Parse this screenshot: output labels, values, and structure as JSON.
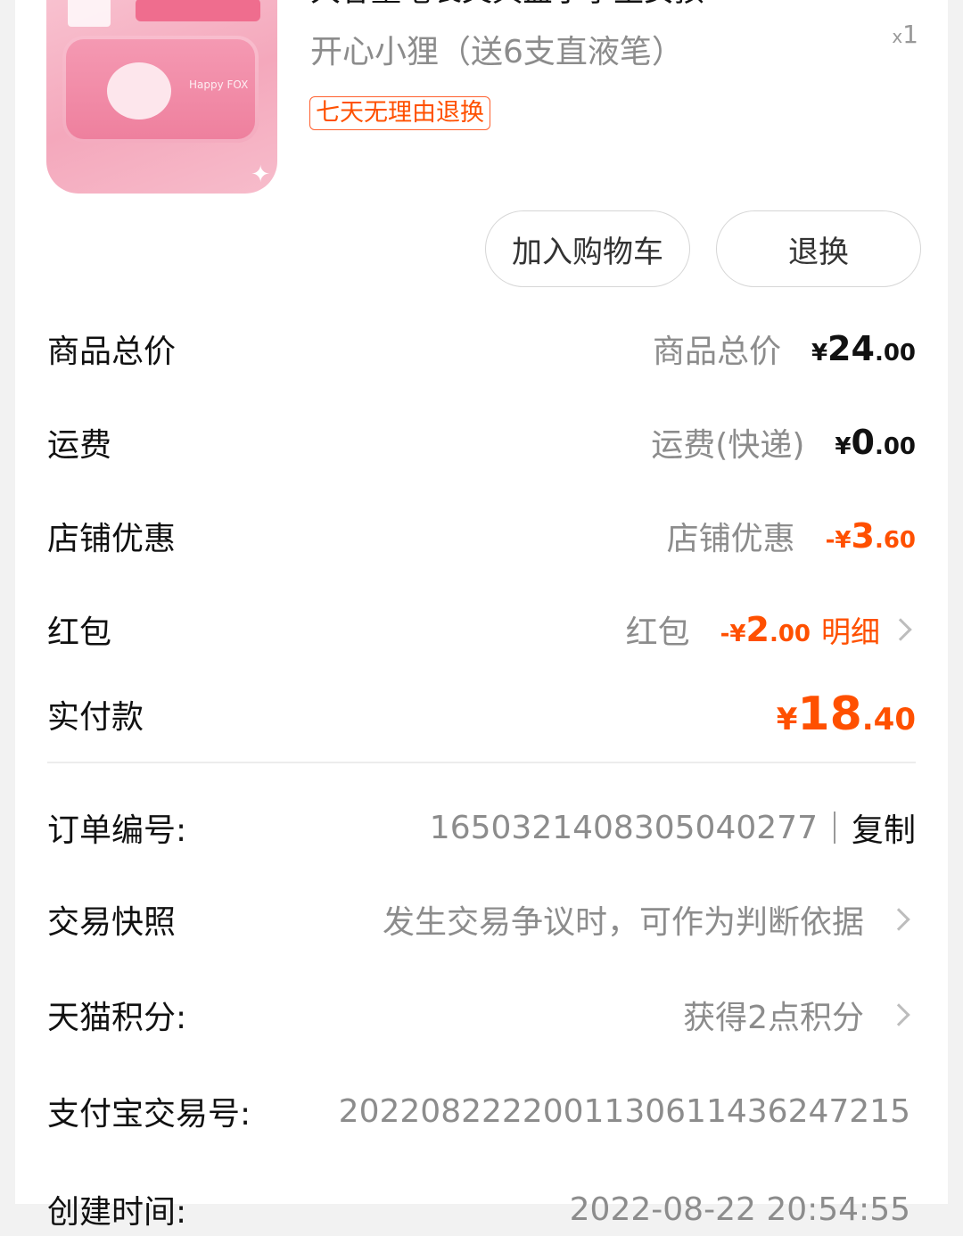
{
  "product": {
    "title": "大容量笔袋文具盒小学生女孩",
    "sku": "开心小狸（送6支直液笔）",
    "qty_prefix": "x",
    "qty": "1",
    "badge": "七天无理由退换",
    "image_caption": "Happy FOX",
    "buttons": {
      "add_cart": "加入购物车",
      "return": "退换"
    }
  },
  "price": {
    "goods_total": {
      "label": "商品总价",
      "sub": "商品总价",
      "cur": "¥",
      "int": "24",
      "dec": ".00"
    },
    "shipping": {
      "label": "运费",
      "sub": "运费(快递)",
      "cur": "¥",
      "int": "0",
      "dec": ".00"
    },
    "store_discount": {
      "label": "店铺优惠",
      "sub": "店铺优惠",
      "cur": "-¥",
      "int": "3",
      "dec": ".60"
    },
    "red_packet": {
      "label": "红包",
      "sub": "红包",
      "cur": "-¥",
      "int": "2",
      "dec": ".00",
      "detail": "明细"
    },
    "paid": {
      "label": "实付款",
      "cur": "¥",
      "int": "18",
      "dec": ".40"
    }
  },
  "info": {
    "order_no": {
      "label": "订单编号:",
      "value": "1650321408305040277",
      "copy": "复制"
    },
    "snapshot": {
      "label": "交易快照",
      "value": "发生交易争议时，可作为判断依据"
    },
    "points": {
      "label": "天猫积分:",
      "value": "获得2点积分"
    },
    "alipay": {
      "label": "支付宝交易号:",
      "value": "2022082222001130611436247215"
    },
    "created": {
      "label": "创建时间:",
      "value": "2022-08-22 20:54:55"
    }
  },
  "colors": {
    "accent": "#ff5000",
    "muted": "#8c8c8c"
  }
}
